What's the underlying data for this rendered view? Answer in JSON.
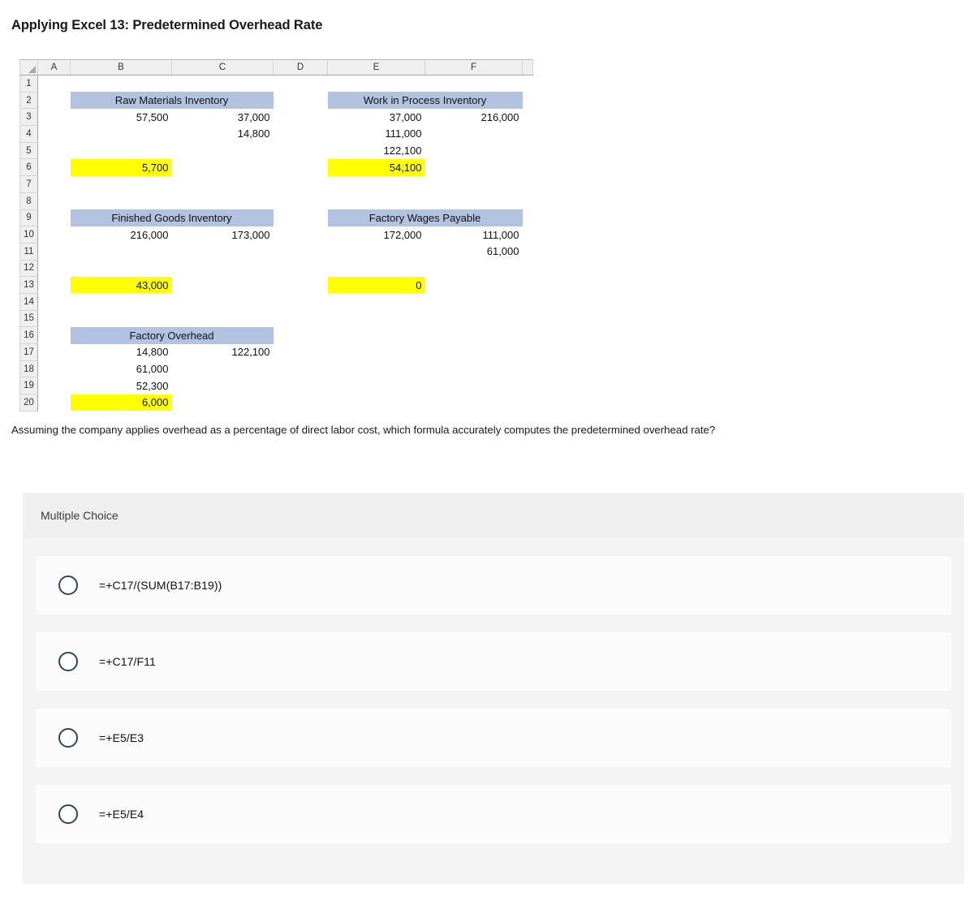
{
  "page": {
    "title": "Applying Excel 13: Predetermined Overhead Rate",
    "question": "Assuming the company applies overhead as a percentage of direct labor cost, which formula accurately computes the predetermined overhead rate?"
  },
  "spreadsheet": {
    "column_headers": [
      "A",
      "B",
      "C",
      "D",
      "E",
      "F"
    ],
    "row_headers": [
      "1",
      "2",
      "3",
      "4",
      "5",
      "6",
      "7",
      "8",
      "9",
      "10",
      "11",
      "12",
      "13",
      "14",
      "15",
      "16",
      "17",
      "18",
      "19",
      "20"
    ],
    "accounts": {
      "raw_materials": {
        "title": "Raw Materials Inventory",
        "title_row": "2",
        "debits": [
          "57,500",
          "",
          "",
          "5,700"
        ],
        "credits": [
          "37,000",
          "14,800",
          "",
          ""
        ],
        "balance": "5,700",
        "balance_cell": "B6",
        "balance_highlight_color": "#ffff00"
      },
      "work_in_process": {
        "title": "Work in Process Inventory",
        "title_row": "2",
        "debits": [
          "37,000",
          "111,000",
          "122,100",
          "54,100"
        ],
        "credits": [
          "216,000",
          "",
          "",
          ""
        ],
        "balance": "54,100",
        "balance_cell": "E6",
        "balance_highlight_color": "#ffff00"
      },
      "finished_goods": {
        "title": "Finished Goods Inventory",
        "title_row": "9",
        "debits": [
          "216,000",
          "",
          "",
          "43,000"
        ],
        "credits": [
          "173,000",
          "",
          "",
          ""
        ],
        "balance": "43,000",
        "balance_cell": "B13",
        "balance_highlight_color": "#ffff00"
      },
      "factory_wages": {
        "title": "Factory Wages Payable",
        "title_row": "9",
        "debits": [
          "172,000",
          "",
          "",
          "0"
        ],
        "credits": [
          "111,000",
          "61,000",
          "",
          ""
        ],
        "balance": "0",
        "balance_cell": "E13",
        "balance_highlight_color": "#ffff00"
      },
      "factory_overhead": {
        "title": "Factory Overhead",
        "title_row": "16",
        "debits": [
          "14,800",
          "61,000",
          "52,300",
          "6,000"
        ],
        "credits": [
          "122,100",
          "",
          "",
          ""
        ],
        "balance": "6,000",
        "balance_cell": "B20",
        "balance_highlight_color": "#ffff00"
      }
    },
    "header_band_color": "#b2c3e0"
  },
  "multiple_choice": {
    "header_label": "Multiple Choice",
    "options": [
      {
        "id": "opt-1",
        "label": "=+C17/(SUM(B17:B19))",
        "selected": false
      },
      {
        "id": "opt-2",
        "label": "=+C17/F11",
        "selected": false
      },
      {
        "id": "opt-3",
        "label": "=+E5/E3",
        "selected": false
      },
      {
        "id": "opt-4",
        "label": "=+E5/E4",
        "selected": false
      }
    ]
  }
}
